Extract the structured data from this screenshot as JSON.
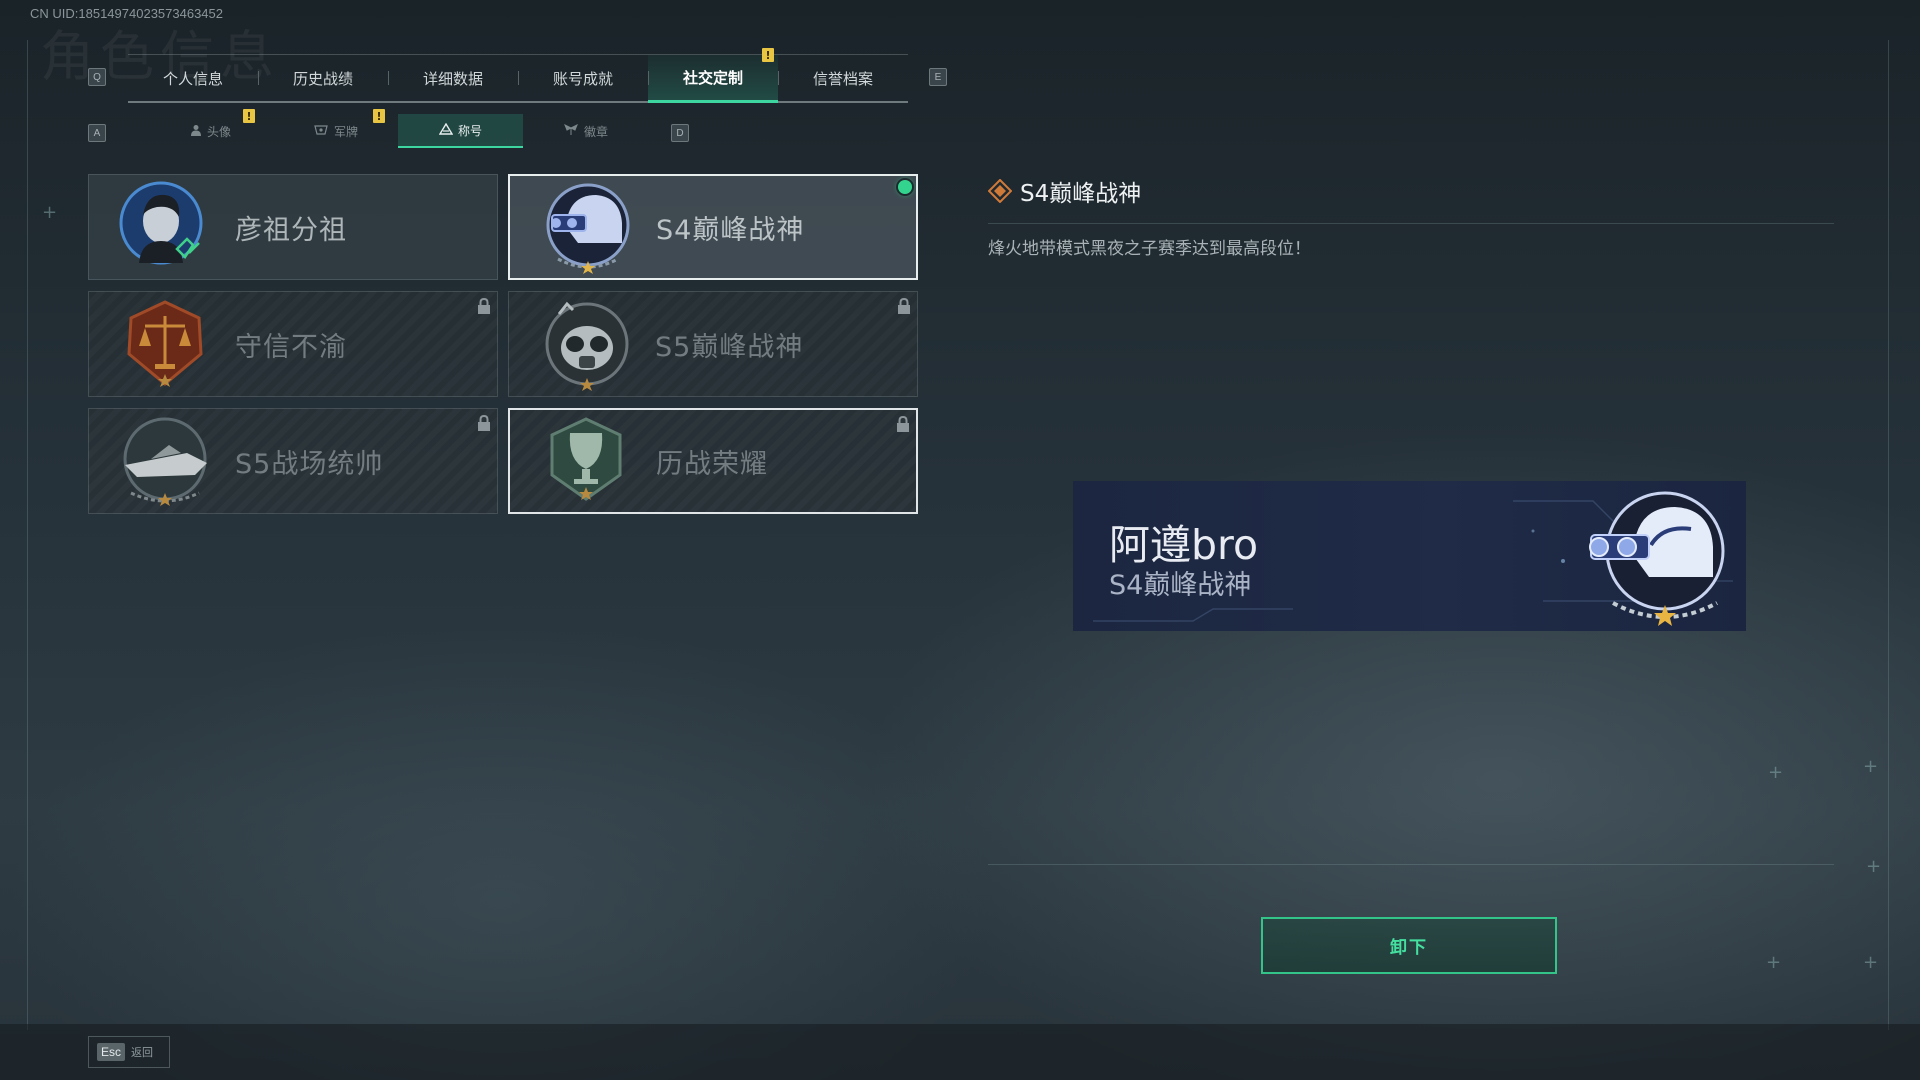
{
  "uid_text": "CN UID:18514974023573463452",
  "header": {
    "bg_title": "角色信息",
    "prev_key": "Q",
    "next_key": "E",
    "tabs": [
      {
        "label": "个人信息"
      },
      {
        "label": "历史战绩"
      },
      {
        "label": "详细数据"
      },
      {
        "label": "账号成就"
      },
      {
        "label": "社交定制",
        "active": true,
        "badge": "!"
      },
      {
        "label": "信誉档案"
      }
    ]
  },
  "subnav": {
    "prev_key": "A",
    "next_key": "D",
    "tabs": [
      {
        "label": "头像",
        "icon": "person-icon",
        "badge": "!"
      },
      {
        "label": "军牌",
        "icon": "dogtag-icon",
        "badge": "!"
      },
      {
        "label": "称号",
        "icon": "triangle-icon",
        "active": true
      },
      {
        "label": "徽章",
        "icon": "wings-icon"
      }
    ]
  },
  "titles": [
    {
      "name": "彦祖分祖",
      "emblem": "portrait-emblem-icon",
      "locked": false
    },
    {
      "name": "S4巅峰战神",
      "emblem": "night-vision-helmet-icon",
      "locked": false,
      "equipped": true,
      "selected": true
    },
    {
      "name": "守信不渝",
      "emblem": "scales-emblem-icon",
      "locked": true
    },
    {
      "name": "S5巅峰战神",
      "emblem": "gasmask-emblem-icon",
      "locked": true
    },
    {
      "name": "S5战场统帅",
      "emblem": "speedboat-emblem-icon",
      "locked": true
    },
    {
      "name": "历战荣耀",
      "emblem": "trophy-emblem-icon",
      "locked": true
    }
  ],
  "detail": {
    "title": "S4巅峰战神",
    "description": "烽火地带模式黑夜之子赛季达到最高段位！"
  },
  "preview": {
    "player_name": "阿遵bro",
    "title": "S4巅峰战神"
  },
  "actions": {
    "unequip_label": "卸下",
    "esc_key": "Esc",
    "esc_label": "返回"
  },
  "colors": {
    "accent": "#3ed6a0",
    "equipped_dot": "#33d58e",
    "badge": "#e8c543"
  }
}
